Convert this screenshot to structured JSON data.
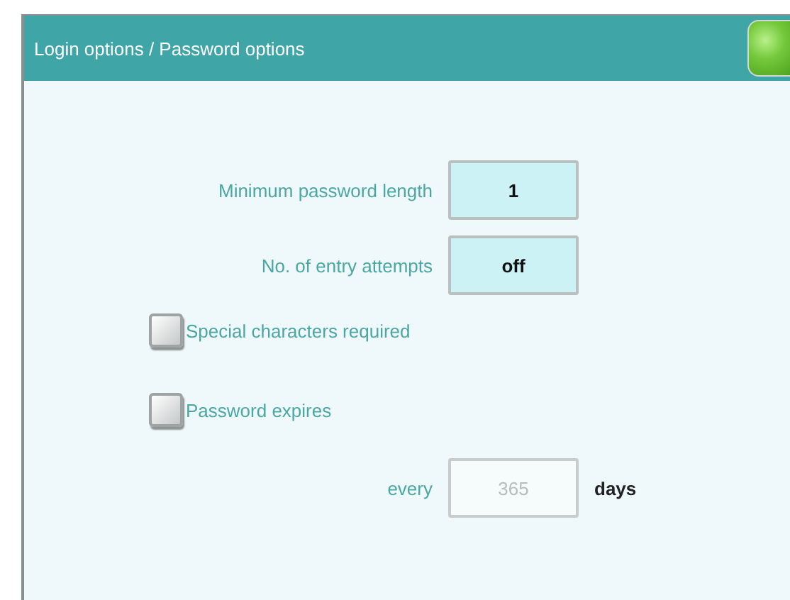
{
  "window": {
    "title": "Login options / Password options"
  },
  "settings": [
    {
      "kind": "field",
      "label": "Minimum password length",
      "value": "1",
      "disabled": false
    },
    {
      "kind": "field",
      "label": "No. of entry attempts",
      "value": "off",
      "disabled": false
    },
    {
      "kind": "checkbox",
      "label": "Special characters required",
      "checked": false
    },
    {
      "kind": "checkbox",
      "label": "Password expires",
      "checked": false
    },
    {
      "kind": "field",
      "label": "every",
      "value": "365",
      "disabled": true,
      "unit": "days"
    }
  ]
}
